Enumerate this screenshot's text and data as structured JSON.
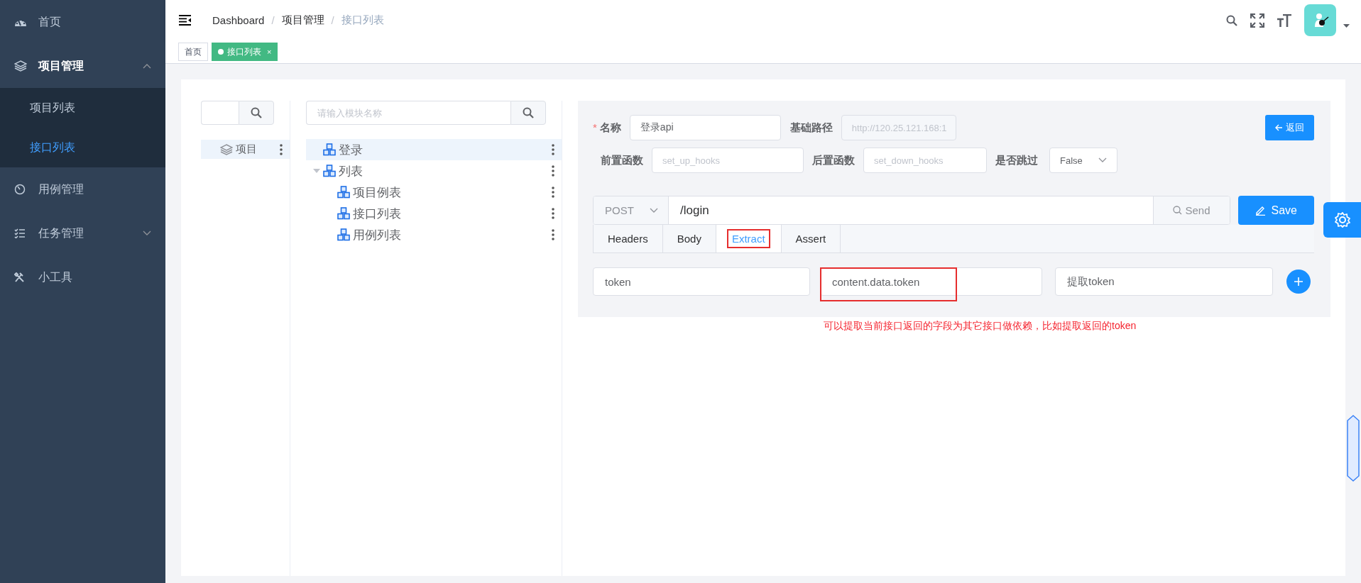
{
  "sidebar": {
    "items": [
      {
        "kind": "link",
        "label": "首页",
        "selected": false
      },
      {
        "kind": "group",
        "label": "项目管理",
        "expanded": true,
        "children": [
          {
            "label": "项目列表",
            "selected": false
          },
          {
            "label": "接口列表",
            "selected": true
          }
        ]
      },
      {
        "kind": "link",
        "label": "用例管理",
        "selected": false
      },
      {
        "kind": "group",
        "label": "任务管理",
        "expanded": false
      },
      {
        "kind": "link",
        "label": "小工具",
        "selected": false
      }
    ]
  },
  "header": {
    "breadcrumb": [
      "Dashboard",
      "项目管理",
      "接口列表"
    ],
    "separator": "/"
  },
  "tag_bar": {
    "tags": [
      {
        "label": "首页",
        "selected": false
      },
      {
        "label": "接口列表",
        "selected": true,
        "close": "×"
      }
    ]
  },
  "projects": {
    "items": [
      {
        "label": "项目",
        "selected": true
      }
    ]
  },
  "modules": {
    "search": {
      "placeholder": "请输入模块名称"
    },
    "tree": [
      {
        "label": "登录",
        "selected": true
      },
      {
        "label": "列表",
        "selected": false,
        "expanded": true,
        "children": [
          {
            "label": "项目例表",
            "selected": false
          },
          {
            "label": "接口列表",
            "selected": false
          },
          {
            "label": "用例列表",
            "selected": false
          }
        ]
      }
    ]
  },
  "form": {
    "name": {
      "label": "名称",
      "required_mark": "*",
      "value": "登录api"
    },
    "base_path": {
      "label": "基础路径",
      "value": "http://120.25.121.168:1",
      "disabled": true
    },
    "back_button": "返回",
    "setup": {
      "label": "前置函数",
      "placeholder": "set_up_hooks"
    },
    "teardown": {
      "label": "后置函数",
      "placeholder": "set_down_hooks"
    },
    "skip": {
      "label": "是否跳过",
      "value": "False"
    }
  },
  "request": {
    "method": "POST",
    "url": "/login",
    "send": "Send",
    "save": "Save"
  },
  "tabs": [
    {
      "label": "Headers",
      "selected": false,
      "highlighted": false
    },
    {
      "label": "Body",
      "selected": false,
      "highlighted": false
    },
    {
      "label": "Extract",
      "selected": true,
      "highlighted": true
    },
    {
      "label": "Assert",
      "selected": false,
      "highlighted": false
    }
  ],
  "extract_rows": [
    {
      "fields": [
        {
          "value": "token",
          "highlighted": false
        },
        {
          "value": "content.data.token",
          "highlighted": true
        },
        {
          "value": "提取token",
          "highlighted": false
        }
      ]
    }
  ],
  "note": "可以提取当前接口返回的字段为其它接口做依赖，比如提取返回的token"
}
